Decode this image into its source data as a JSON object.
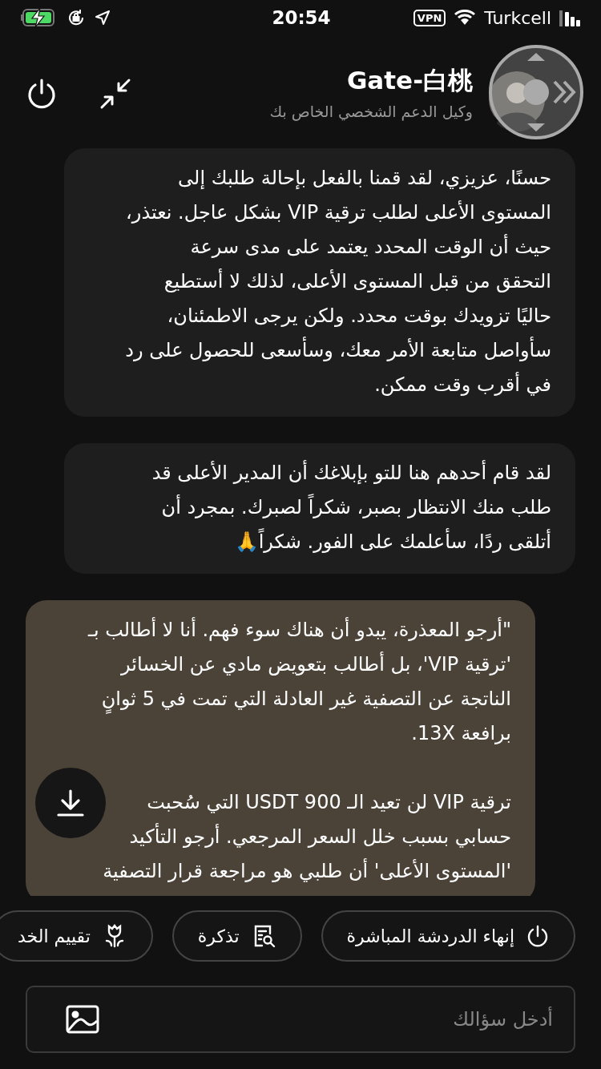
{
  "status_bar": {
    "time": "20:54",
    "vpn": "VPN",
    "carrier": "Turkcell"
  },
  "header": {
    "title": "Gate-白桃",
    "subtitle": "وكيل الدعم الشخصي الخاص بك"
  },
  "messages": [
    {
      "kind": "agent",
      "paragraphs": [
        [
          "حسنًا، عزيزي، لقد قمنا بالفعل بإحالة طلبك إلى",
          "المستوى الأعلى لطلب ترقية VIP بشكل عاجل. نعتذر،",
          "حيث أن الوقت المحدد يعتمد على مدى سرعة",
          "التحقق من قبل المستوى الأعلى، لذلك لا أستطيع",
          "حاليًا تزويدك بوقت محدد. ولكن يرجى الاطمئنان،",
          "سأواصل متابعة الأمر معك، وسأسعى للحصول على رد",
          "في أقرب وقت ممكن."
        ]
      ]
    },
    {
      "kind": "agent",
      "paragraphs": [
        [
          "لقد قام أحدهم هنا للتو بإبلاغك أن المدير الأعلى قد",
          "طلب منك الانتظار بصبر، شكراً لصبرك. بمجرد أن",
          "أتلقى ردًا، سأعلمك على الفور. شكراً🙏"
        ]
      ]
    },
    {
      "kind": "user",
      "paragraphs": [
        [
          "\"أرجو المعذرة، يبدو أن هناك سوء فهم. أنا لا أطالب بـ",
          "'ترقية VIP'، بل أطالب بتعويض مادي عن الخسائر",
          "الناتجة عن التصفية غير العادلة التي تمت في 5 ثوانٍ",
          "برافعة 13X."
        ],
        [
          "ترقية VIP لن تعيد الـ 900 USDT التي سُحبت",
          "حسابي بسبب خلل السعر المرجعي. أرجو التأكيد",
          "'المستوى الأعلى' أن طلبي هو مراجعة قرار التصفية"
        ]
      ]
    }
  ],
  "actions": [
    {
      "kind": "end",
      "label": "إنهاء الدردشة المباشرة"
    },
    {
      "kind": "ticket",
      "label": "تذكرة"
    },
    {
      "kind": "rating",
      "label": "تقييم الخد"
    }
  ],
  "input": {
    "placeholder": "أدخل سؤالك"
  }
}
